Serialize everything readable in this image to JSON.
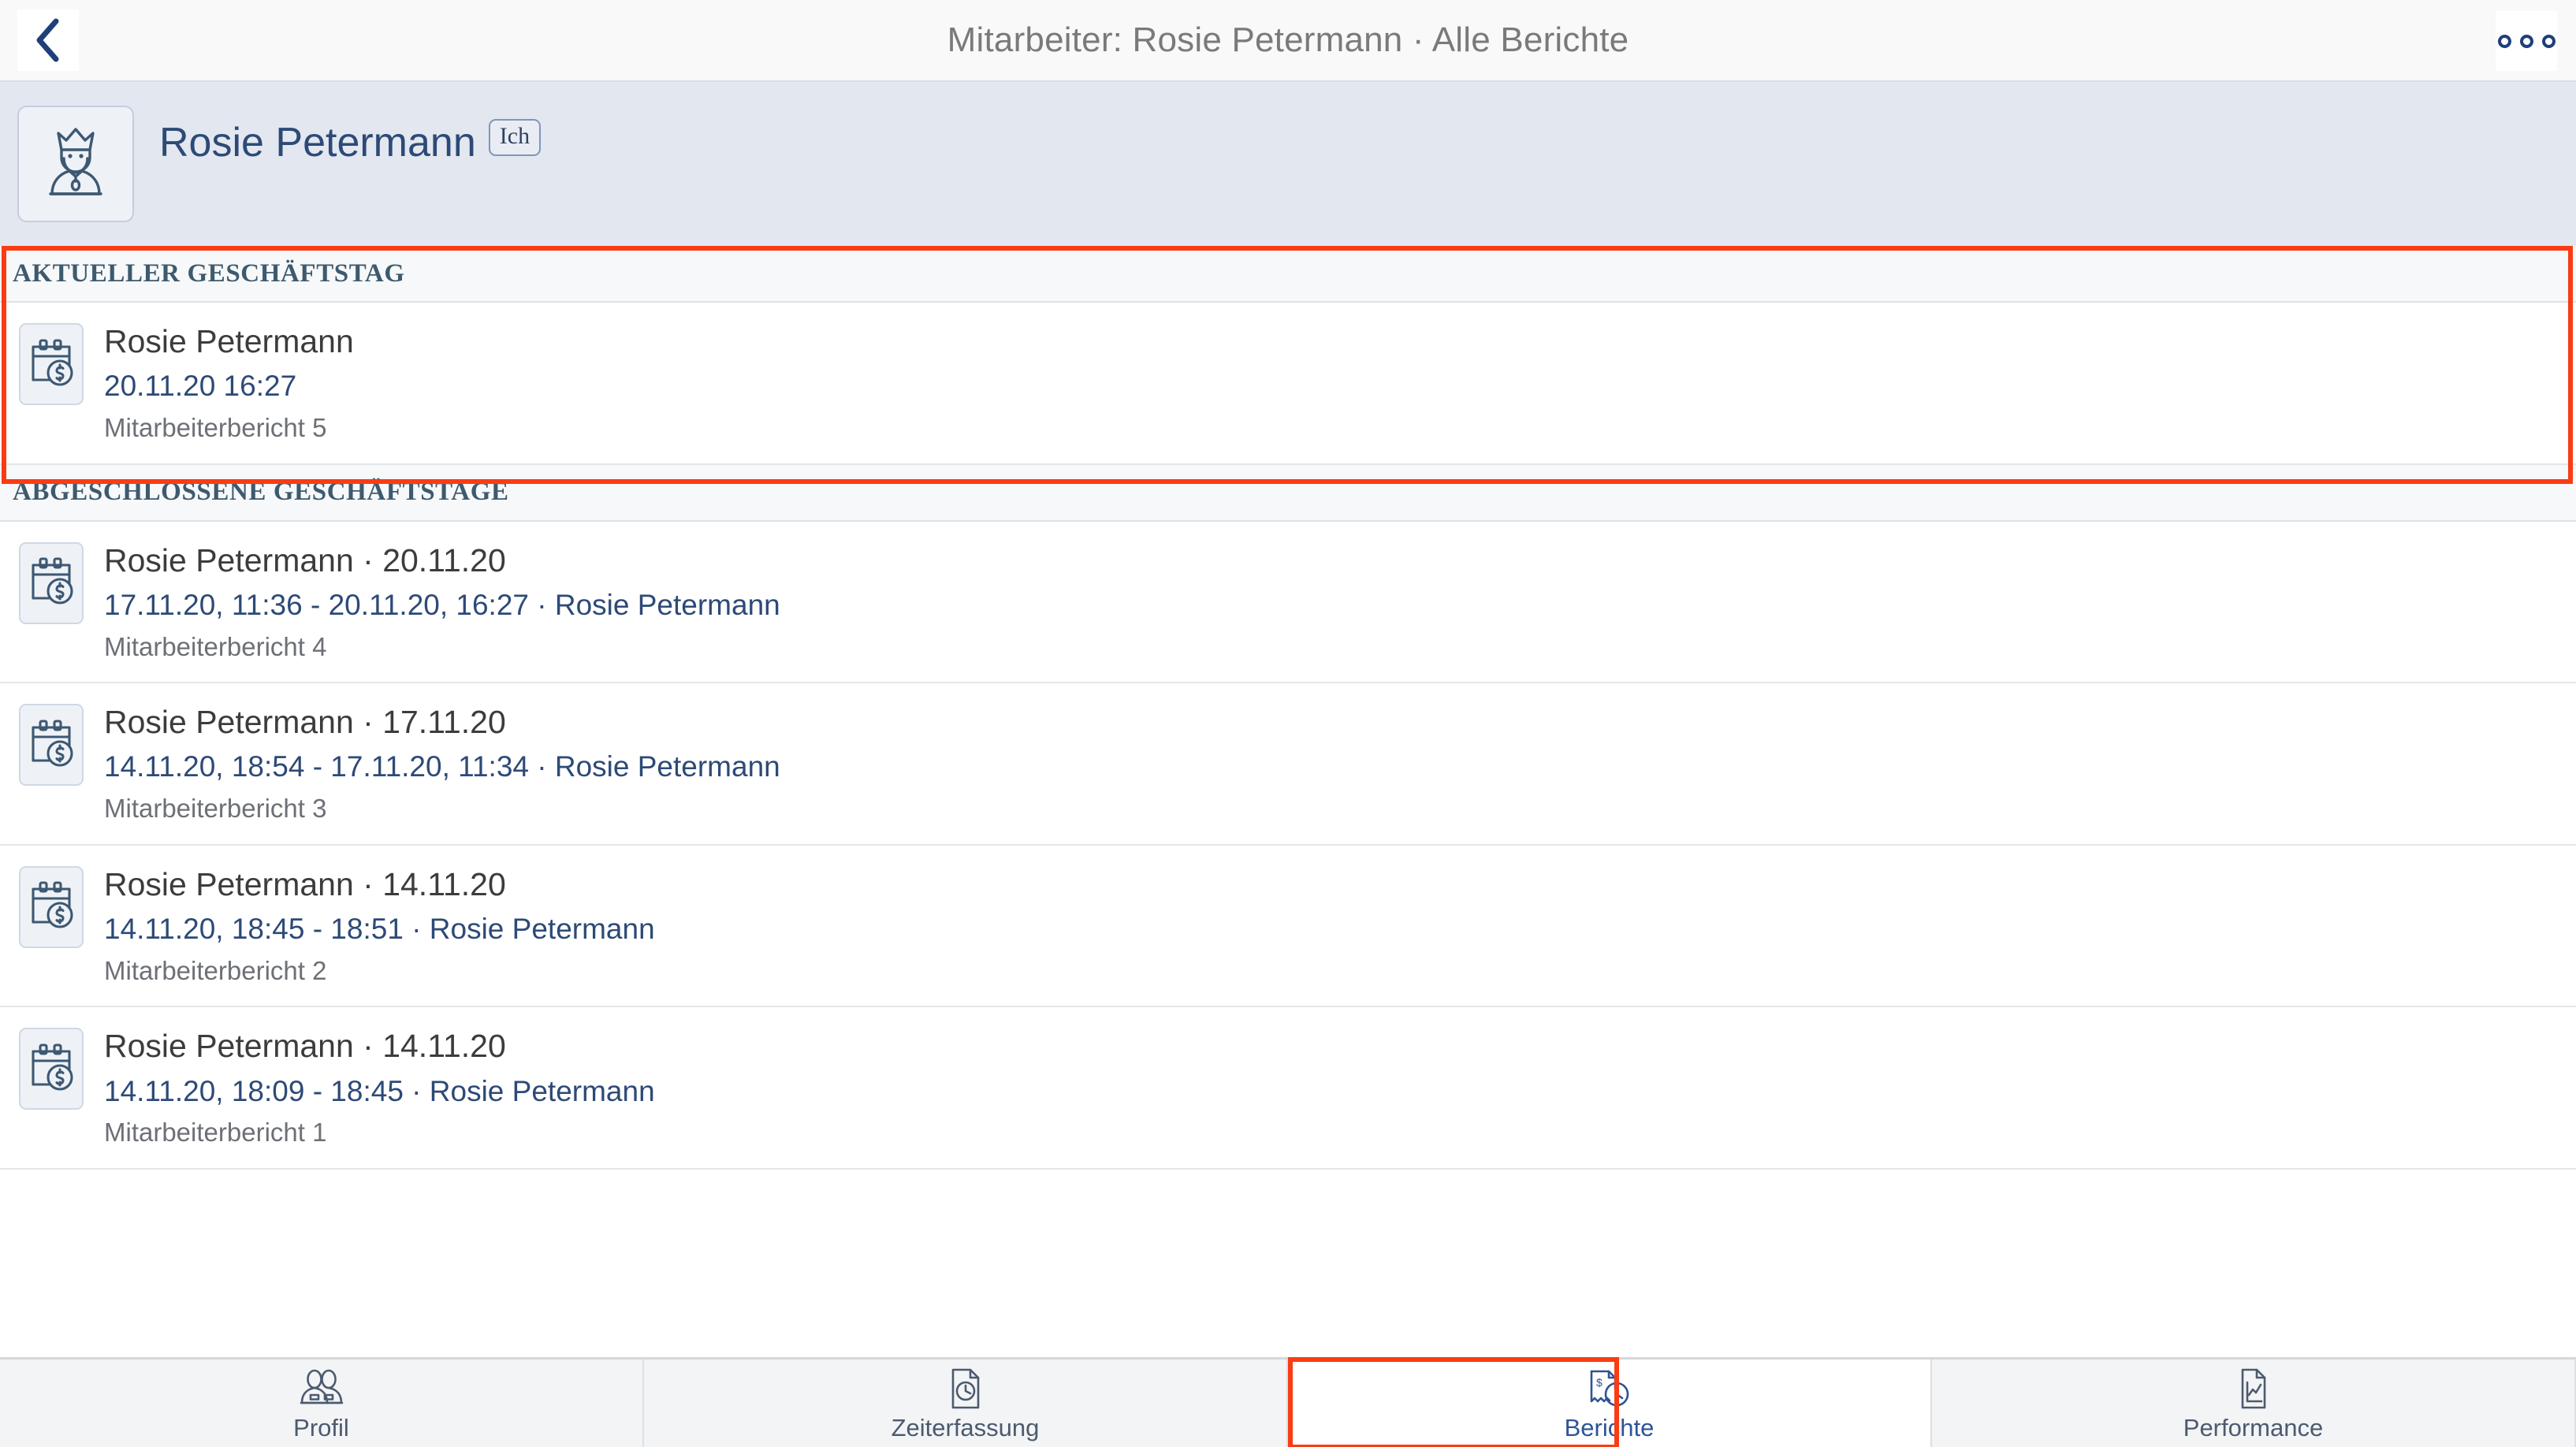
{
  "nav": {
    "back_icon": "chevron-left-icon",
    "title": "Mitarbeiter: Rosie Petermann · Alle Berichte",
    "more_icon": "overflow-menu-icon"
  },
  "profile": {
    "avatar_icon": "king-avatar-icon",
    "name": "Rosie Petermann",
    "badge": "Ich"
  },
  "sections": [
    {
      "label": "AKTUELLER GESCHÄFTSTAG",
      "highlighted": true,
      "rows": [
        {
          "icon": "calendar-dollar-icon",
          "title": "Rosie Petermann",
          "subtitle": "20.11.20 16:27",
          "meta": "Mitarbeiterbericht 5"
        }
      ]
    },
    {
      "label": "ABGESCHLOSSENE GESCHÄFTSTAGE",
      "highlighted": false,
      "rows": [
        {
          "icon": "calendar-dollar-icon",
          "title": "Rosie Petermann · 20.11.20",
          "subtitle": "17.11.20, 11:36 - 20.11.20, 16:27 · Rosie Petermann",
          "meta": "Mitarbeiterbericht 4"
        },
        {
          "icon": "calendar-dollar-icon",
          "title": "Rosie Petermann · 17.11.20",
          "subtitle": "14.11.20, 18:54 - 17.11.20, 11:34 · Rosie Petermann",
          "meta": "Mitarbeiterbericht 3"
        },
        {
          "icon": "calendar-dollar-icon",
          "title": "Rosie Petermann · 14.11.20",
          "subtitle": "14.11.20, 18:45 - 18:51 · Rosie Petermann",
          "meta": "Mitarbeiterbericht 2"
        },
        {
          "icon": "calendar-dollar-icon",
          "title": "Rosie Petermann · 14.11.20",
          "subtitle": "14.11.20, 18:09 - 18:45 · Rosie Petermann",
          "meta": "Mitarbeiterbericht 1"
        }
      ]
    }
  ],
  "tabs": [
    {
      "label": "Profil",
      "icon": "two-people-icon",
      "active": false,
      "highlighted": false
    },
    {
      "label": "Zeiterfassung",
      "icon": "document-clock-icon",
      "active": false,
      "highlighted": false
    },
    {
      "label": "Berichte",
      "icon": "receipt-clock-icon",
      "active": true,
      "highlighted": true
    },
    {
      "label": "Performance",
      "icon": "document-chart-icon",
      "active": false,
      "highlighted": false
    }
  ],
  "colors": {
    "accent_blue": "#2d4a77",
    "highlight_red": "#fa3c14",
    "header_bg": "#e3e7ef",
    "section_bg": "#f7f8f9",
    "tabbar_bg": "#f3f4f6",
    "icon_navy": "#3d5872"
  }
}
